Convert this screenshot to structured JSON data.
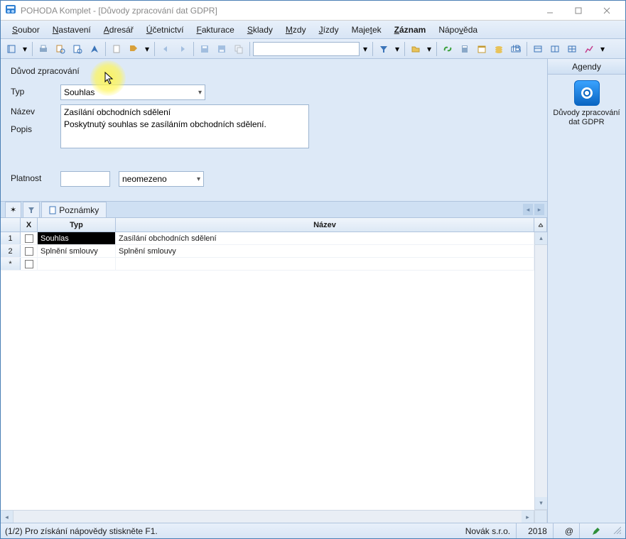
{
  "window": {
    "title": "POHODA Komplet - [Důvody zpracování dat GDPR]"
  },
  "menu": {
    "soubor": "Soubor",
    "nastaveni": "Nastavení",
    "adresar": "Adresář",
    "ucetnictvi": "Účetnictví",
    "fakturace": "Fakturace",
    "sklady": "Sklady",
    "mzdy": "Mzdy",
    "jizdy": "Jízdy",
    "majetek": "Majetek",
    "zaznam": "Záznam",
    "napoveda": "Nápověda"
  },
  "form": {
    "section_title": "Důvod zpracování",
    "typ_label": "Typ",
    "typ_value": "Souhlas",
    "nazev_label": "Název",
    "nazev_value": "Zasílání obchodních sdělení",
    "popis_label": "Popis",
    "popis_value": "Poskytnutý souhlas se zasíláním obchodních sdělení.",
    "platnost_label": "Platnost",
    "platnost_value": "",
    "platnost_mode": "neomezeno"
  },
  "tabs": {
    "poznamky": "Poznámky"
  },
  "grid": {
    "headers": {
      "x": "X",
      "typ": "Typ",
      "nazev": "Název"
    },
    "rows": [
      {
        "num": "1",
        "typ": "Souhlas",
        "nazev": "Zasílání obchodních sdělení",
        "selected": true
      },
      {
        "num": "2",
        "typ": "Splnění smlouvy",
        "nazev": "Splnění smlouvy",
        "selected": false
      }
    ],
    "placeholder_row": "*"
  },
  "side": {
    "header": "Agendy",
    "item_label": "Důvody zpracování dat GDPR"
  },
  "status": {
    "left": "(1/2) Pro získání nápovědy stiskněte F1.",
    "company": "Novák s.r.o.",
    "year": "2018",
    "at": "@"
  }
}
